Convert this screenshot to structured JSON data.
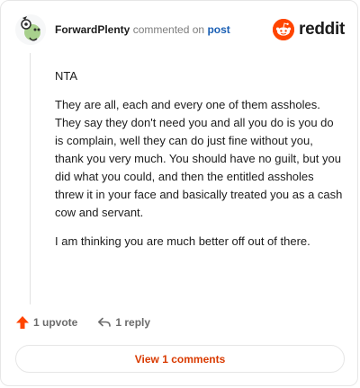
{
  "header": {
    "username": "ForwardPlenty",
    "action_text": "commented on",
    "post_link": "post",
    "logo_text": "reddit"
  },
  "icons": {
    "avatar": "snoo-avatar-icon",
    "logo": "reddit-logo-icon",
    "upvote": "upvote-arrow-icon",
    "reply": "reply-arrow-icon"
  },
  "comment": {
    "paragraphs": [
      "NTA",
      "They are all, each and every one of them assholes. They say they don't need you and all you do is you do is complain, well they can do just fine without you, thank you very much. You should have no guilt, but you did what you could, and then the entitled assholes threw it in your face and basically treated you as a cash cow and servant.",
      "I am thinking you are much better off out of there."
    ]
  },
  "actions": {
    "upvote_label": "1 upvote",
    "reply_label": "1 reply"
  },
  "footer": {
    "view_comments_label": "View 1 comments"
  },
  "colors": {
    "brand": "#ff4500",
    "link": "#1a5fb4",
    "button_text": "#d93a00",
    "muted": "#6b6b6b"
  }
}
